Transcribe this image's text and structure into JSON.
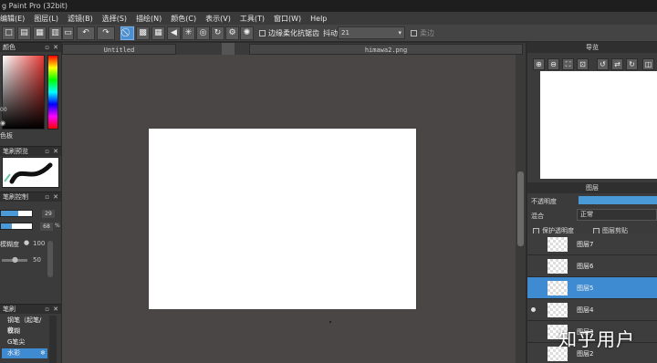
{
  "titlebar": {
    "title": "g Paint Pro (32bit)"
  },
  "menu": [
    "编辑(E)",
    "图层(L)",
    "滤镜(B)",
    "选择(S)",
    "描绘(N)",
    "颜色(C)",
    "表示(V)",
    "工具(T)",
    "窗口(W)",
    "Help"
  ],
  "toolbar": {
    "antialias_label": "边缘柔化抗锯齿",
    "stabilizer_label": "抖动修正",
    "stabilizer_value": "21",
    "soft_edge_label": "柔边"
  },
  "left_panel": {
    "color_title": "颜色",
    "color_side_value": "00",
    "palette_label": "色板",
    "brush_preview_title": "笔刷预览",
    "brush_control_title": "笔刷控制",
    "size_value": "29",
    "opacity_value": "68",
    "opacity_unit": "%",
    "blur_label": "模糊度",
    "blur_value": "100",
    "spacing_value": "50",
    "brush_list_title": "笔刷",
    "brush_items": [
      "钢笔（起笔/收",
      "模糊",
      "G笔尖",
      "水彩"
    ],
    "size_fraction": 0.55,
    "opacity_fraction": 0.35
  },
  "documents": {
    "tabs": [
      "Untitled",
      "himawa2.png"
    ]
  },
  "navigator": {
    "title": "导览"
  },
  "layers": {
    "title": "图层",
    "opacity_label": "不透明度",
    "blend_label": "混合",
    "blend_value": "正常",
    "protect_alpha_label": "保护透明度",
    "clip_label": "图层剪贴",
    "items": [
      {
        "name": "图层7",
        "selected": false,
        "visible": false
      },
      {
        "name": "图层6",
        "selected": false,
        "visible": false
      },
      {
        "name": "图层5",
        "selected": true,
        "visible": false
      },
      {
        "name": "图层4",
        "selected": false,
        "visible": true
      },
      {
        "name": "图层3",
        "selected": false,
        "visible": false
      },
      {
        "name": "图层2",
        "selected": false,
        "visible": false
      }
    ]
  },
  "watermark": "知乎用户",
  "colors": {
    "accent": "#4b8fd1",
    "canvas_bg": "#4a4645",
    "panel_bg": "#3b3b3b"
  }
}
